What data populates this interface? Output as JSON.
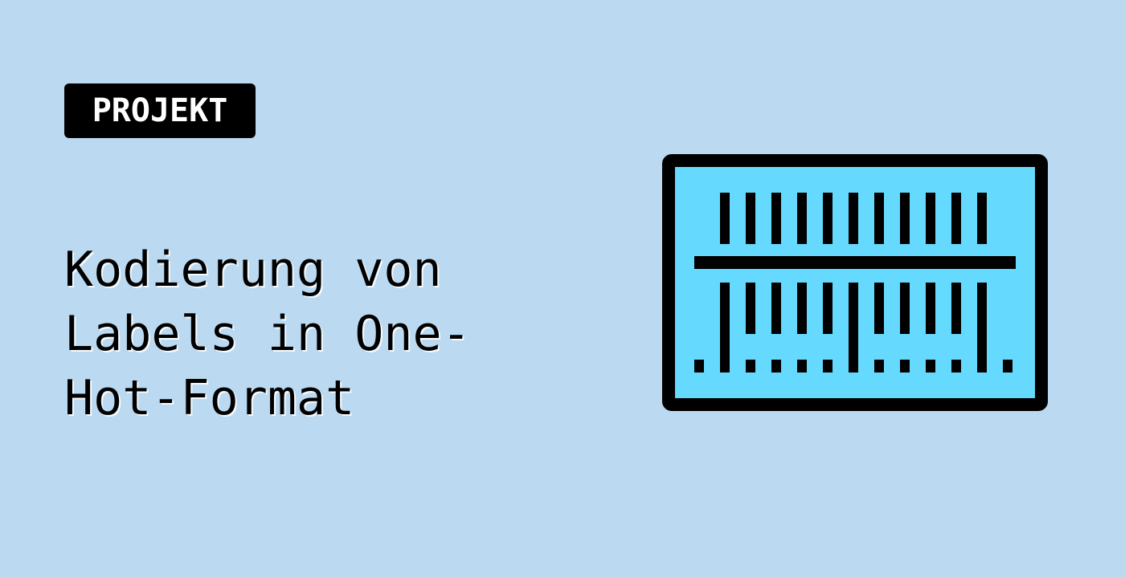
{
  "tag": {
    "label": "PROJEKT"
  },
  "title": {
    "lines": [
      "Kodierung von",
      "Labels in One-",
      "Hot-Format"
    ]
  },
  "illustration": {
    "icon": "one-hot-encoding-icon",
    "column_count": 12
  },
  "colors": {
    "background": "#bbdaf1",
    "tag_background": "#000000",
    "tag_text": "#ffffff",
    "title_text": "#000000",
    "illustration_fill": "#66d9ff",
    "illustration_stroke": "#000000"
  }
}
